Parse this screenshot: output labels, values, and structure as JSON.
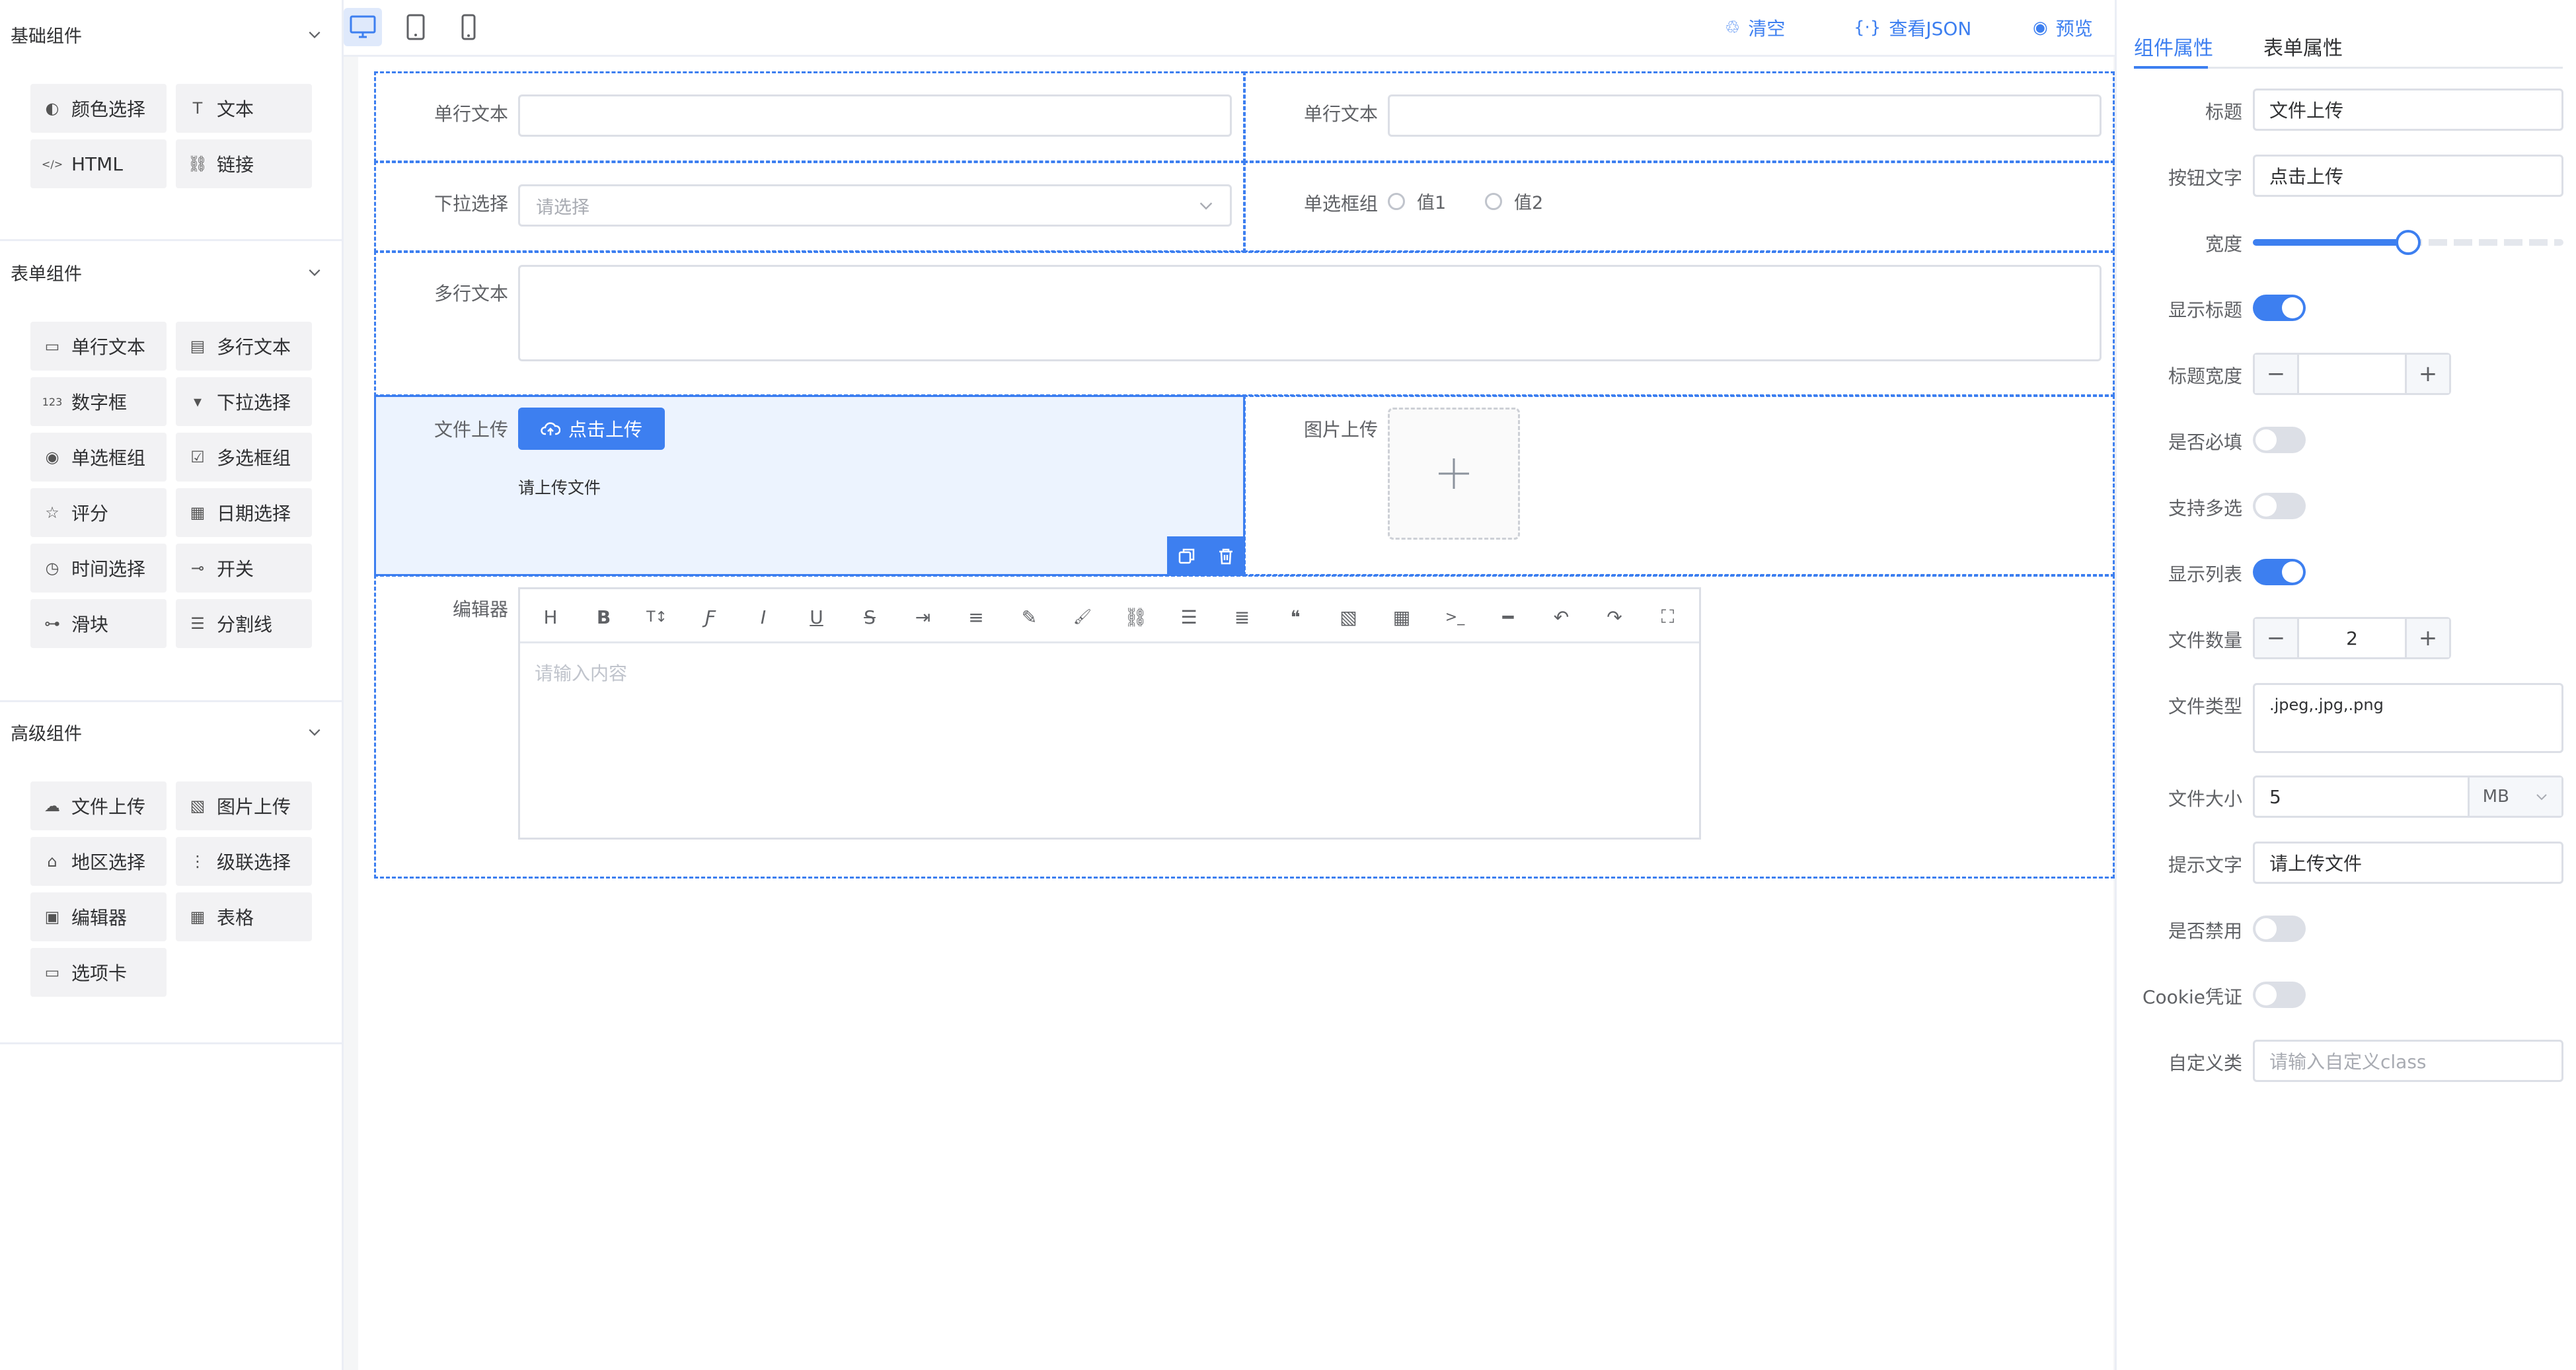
{
  "left": {
    "basic": {
      "title": "基础组件",
      "items": [
        {
          "label": "颜色选择",
          "icon": "palette-icon",
          "glyph": "◐"
        },
        {
          "label": "文本",
          "icon": "text-icon",
          "glyph": "T"
        },
        {
          "label": "HTML",
          "icon": "code-icon",
          "glyph": "</>"
        },
        {
          "label": "链接",
          "icon": "link-icon",
          "glyph": "⛓"
        }
      ]
    },
    "form": {
      "title": "表单组件",
      "items": [
        {
          "label": "单行文本",
          "icon": "input-icon",
          "glyph": "▭"
        },
        {
          "label": "多行文本",
          "icon": "textarea-icon",
          "glyph": "▤"
        },
        {
          "label": "数字框",
          "icon": "number-icon",
          "glyph": "123"
        },
        {
          "label": "下拉选择",
          "icon": "select-icon",
          "glyph": "▾"
        },
        {
          "label": "单选框组",
          "icon": "radio-icon",
          "glyph": "◉"
        },
        {
          "label": "多选框组",
          "icon": "checkbox-icon",
          "glyph": "☑"
        },
        {
          "label": "评分",
          "icon": "star-icon",
          "glyph": "☆"
        },
        {
          "label": "日期选择",
          "icon": "calendar-icon",
          "glyph": "▦"
        },
        {
          "label": "时间选择",
          "icon": "clock-icon",
          "glyph": "◷"
        },
        {
          "label": "开关",
          "icon": "switch-icon",
          "glyph": "⊸"
        },
        {
          "label": "滑块",
          "icon": "slider-icon",
          "glyph": "⊶"
        },
        {
          "label": "分割线",
          "icon": "divider-icon",
          "glyph": "☰"
        }
      ]
    },
    "advanced": {
      "title": "高级组件",
      "items": [
        {
          "label": "文件上传",
          "icon": "cloud-upload-icon",
          "glyph": "☁"
        },
        {
          "label": "图片上传",
          "icon": "image-icon",
          "glyph": "▧"
        },
        {
          "label": "地区选择",
          "icon": "region-icon",
          "glyph": "⌂"
        },
        {
          "label": "级联选择",
          "icon": "cascader-icon",
          "glyph": "⋮"
        },
        {
          "label": "编辑器",
          "icon": "editor-icon",
          "glyph": "▣"
        },
        {
          "label": "表格",
          "icon": "table-icon",
          "glyph": "▦"
        },
        {
          "label": "选项卡",
          "icon": "tabs-icon",
          "glyph": "▭"
        }
      ]
    }
  },
  "toolbar": {
    "clear": "清空",
    "view_json": "查看JSON",
    "preview": "预览"
  },
  "form": {
    "row1": {
      "left_label": "单行文本",
      "right_label": "单行文本"
    },
    "row2": {
      "select_label": "下拉选择",
      "select_placeholder": "请选择",
      "radio_label": "单选框组",
      "radio_options": [
        "值1",
        "值2"
      ]
    },
    "row3": {
      "label": "多行文本"
    },
    "row4": {
      "file_label": "文件上传",
      "upload_button": "点击上传",
      "tip": "请上传文件",
      "image_label": "图片上传"
    },
    "row5": {
      "label": "编辑器",
      "placeholder": "请输入内容"
    }
  },
  "props": {
    "tabs": [
      "组件属性",
      "表单属性"
    ],
    "title_label": "标题",
    "title_value": "文件上传",
    "button_text_label": "按钮文字",
    "button_text_value": "点击上传",
    "width_label": "宽度",
    "width_value": 0.5,
    "show_title_label": "显示标题",
    "show_title": true,
    "title_width_label": "标题宽度",
    "title_width_value": "",
    "required_label": "是否必填",
    "required": false,
    "multiple_label": "支持多选",
    "multiple": false,
    "show_list_label": "显示列表",
    "show_list": true,
    "file_count_label": "文件数量",
    "file_count": "2",
    "file_type_label": "文件类型",
    "file_type": ".jpeg,.jpg,.png",
    "file_size_label": "文件大小",
    "file_size": "5",
    "file_size_unit": "MB",
    "tip_label": "提示文字",
    "tip_value": "请上传文件",
    "disabled_label": "是否禁用",
    "disabled": false,
    "cookie_label": "Cookie凭证",
    "cookie": false,
    "class_label": "自定义类",
    "class_placeholder": "请输入自定义class"
  },
  "colors": {
    "accent": "#3d7ff0",
    "selected_bg": "#ecf3fe"
  }
}
